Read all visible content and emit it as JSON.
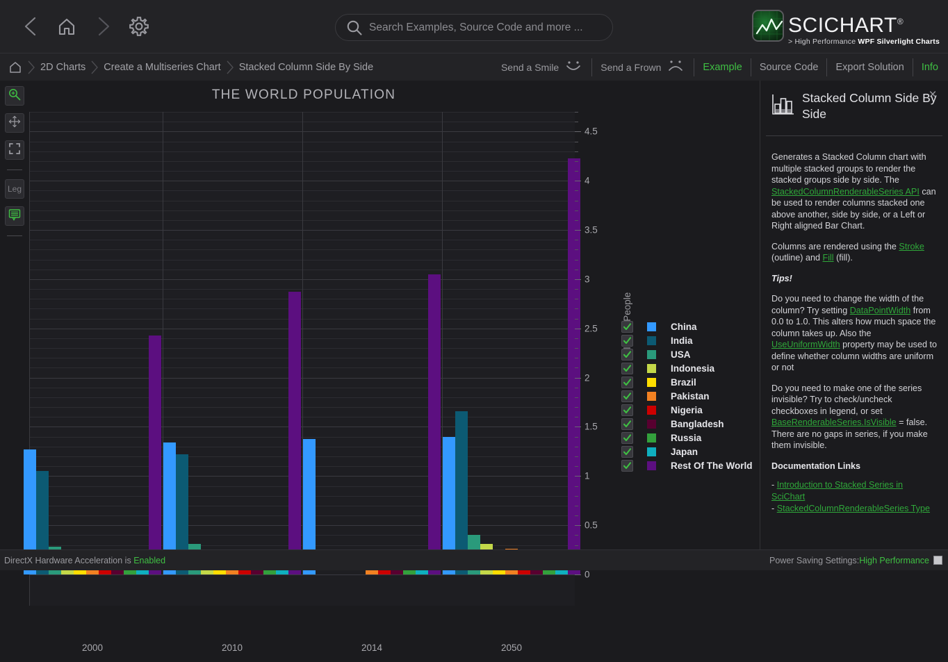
{
  "header": {
    "nav": {
      "back": "back-arrow",
      "home": "home",
      "forward": "forward-arrow",
      "settings": "gear"
    },
    "search": {
      "placeholder": "Search Examples, Source Code and more ...",
      "value": ""
    },
    "logo": {
      "name": "SCICHART",
      "registered": "®",
      "tagline_prefix": "> High Performance ",
      "tagline_bold": "WPF Silverlight Charts"
    }
  },
  "breadcrumb": {
    "items": [
      "2D Charts",
      "Create a Multiseries Chart",
      "Stacked Column Side By Side"
    ],
    "feedback": [
      {
        "label": "Send a Smile",
        "icon": "smile-face-icon"
      },
      {
        "label": "Send a Frown",
        "icon": "frown-face-icon"
      }
    ],
    "tabs": [
      {
        "label": "Example",
        "active": true
      },
      {
        "label": "Source Code",
        "active": false
      },
      {
        "label": "Export Solution",
        "active": false
      },
      {
        "label": "Info",
        "active": true
      }
    ]
  },
  "chart_tools": [
    {
      "name": "zoom-tool",
      "label": "",
      "icon": "magnifier-icon",
      "active": true
    },
    {
      "name": "pan-tool",
      "label": "",
      "icon": "four-arrows-icon",
      "active": false
    },
    {
      "name": "zoom-extents-tool",
      "label": "",
      "icon": "expand-icon",
      "active": false
    },
    {
      "name": "legend-tool",
      "label": "Leg",
      "icon": "legend-icon",
      "active": false
    },
    {
      "name": "rollover-tool",
      "label": "",
      "icon": "tooltip-icon",
      "active": true
    }
  ],
  "chart_data": {
    "type": "bar",
    "title": "THE WORLD POPULATION",
    "xlabel": "",
    "ylabel": "billion of People",
    "categories": [
      "2000",
      "2010",
      "2014",
      "2050"
    ],
    "ylim": [
      0,
      4.7
    ],
    "yticks": [
      0,
      0.5,
      1,
      1.5,
      2,
      2.5,
      3,
      3.5,
      4,
      4.5
    ],
    "ytick_labels": [
      "0",
      "0.5",
      "1",
      "1.5",
      "2",
      "2.5",
      "3",
      "3.5",
      "4",
      "4.5"
    ],
    "grid": true,
    "legend_position": "right",
    "series": [
      {
        "name": "China",
        "color": "#3399FF",
        "values": [
          1.27,
          1.34,
          1.38,
          1.4
        ]
      },
      {
        "name": "India",
        "color": "#0C5A73",
        "values": [
          1.05,
          1.22,
          0.0,
          1.66
        ]
      },
      {
        "name": "USA",
        "color": "#2A9A7B",
        "values": [
          0.28,
          0.31,
          0.0,
          0.4
        ]
      },
      {
        "name": "Indonesia",
        "color": "#C4D849",
        "values": [
          0.21,
          0.24,
          0.0,
          0.31
        ]
      },
      {
        "name": "Brazil",
        "color": "#FFDD00",
        "values": [
          0.17,
          0.2,
          0.0,
          0.23
        ]
      },
      {
        "name": "Pakistan",
        "color": "#F28122",
        "values": [
          0.14,
          0.17,
          0.18,
          0.26
        ]
      },
      {
        "name": "Nigeria",
        "color": "#CC0000",
        "values": [
          0.12,
          0.16,
          0.17,
          0.25
        ]
      },
      {
        "name": "Bangladesh",
        "color": "#580030",
        "values": [
          0.13,
          0.15,
          0.16,
          0.2
        ]
      },
      {
        "name": "Russia",
        "color": "#33A03C",
        "values": [
          0.15,
          0.14,
          0.14,
          0.1
        ]
      },
      {
        "name": "Japan",
        "color": "#0FAFBF",
        "values": [
          0.13,
          0.13,
          0.13,
          0.08
        ]
      },
      {
        "name": "Rest Of The World",
        "color": "#5C0F80",
        "values": [
          2.43,
          2.87,
          3.05,
          4.23
        ]
      }
    ]
  },
  "legend_checked": true,
  "info": {
    "title": "Stacked Column Side By Side",
    "close": "×",
    "body": {
      "p1_a": "Generates a Stacked Column chart with multiple stacked groups to render the stacked groups side by side. The ",
      "p1_link": "StackedColumnRenderableSeries API",
      "p1_b": " can be used to render columns stacked one above another, side by side, or a Left or Right aligned Bar Chart.",
      "p2_a": "Columns are rendered using the ",
      "p2_link1": "Stroke",
      "p2_b": " (outline) and ",
      "p2_link2": "Fill",
      "p2_c": " (fill).",
      "tips_heading": "Tips!",
      "p3_a": "Do you need to change the width of the column? Try setting ",
      "p3_link1": "DataPointWidth",
      "p3_b": " from 0.0 to 1.0. This alters how much space the column takes up. Also the ",
      "p3_link2": "UseUniformWidth",
      "p3_c": " property may be used to define whether column widths are uniform or not",
      "p4_a": "Do you need to make one of the series invisible? Try to check/uncheck checkboxes in legend, or set ",
      "p4_link": "BaseRenderableSeries.IsVisible",
      "p4_b": " = false. There are no gaps in series, if you make them invisible.",
      "doc_heading": "Documentation Links",
      "doc_links": [
        "Introduction to Stacked Series in SciChart",
        "StackedColumnRenderableSeries Type"
      ]
    }
  },
  "statusbar": {
    "left_prefix": "DirectX Hardware Acceleration is ",
    "left_value": "Enabled",
    "right_prefix": "Power Saving Settings: ",
    "right_value": "High Performance"
  },
  "colors": {
    "accent_green": "#3fbf43",
    "panel": "#232326",
    "plot_bg": "#1e1e22"
  }
}
